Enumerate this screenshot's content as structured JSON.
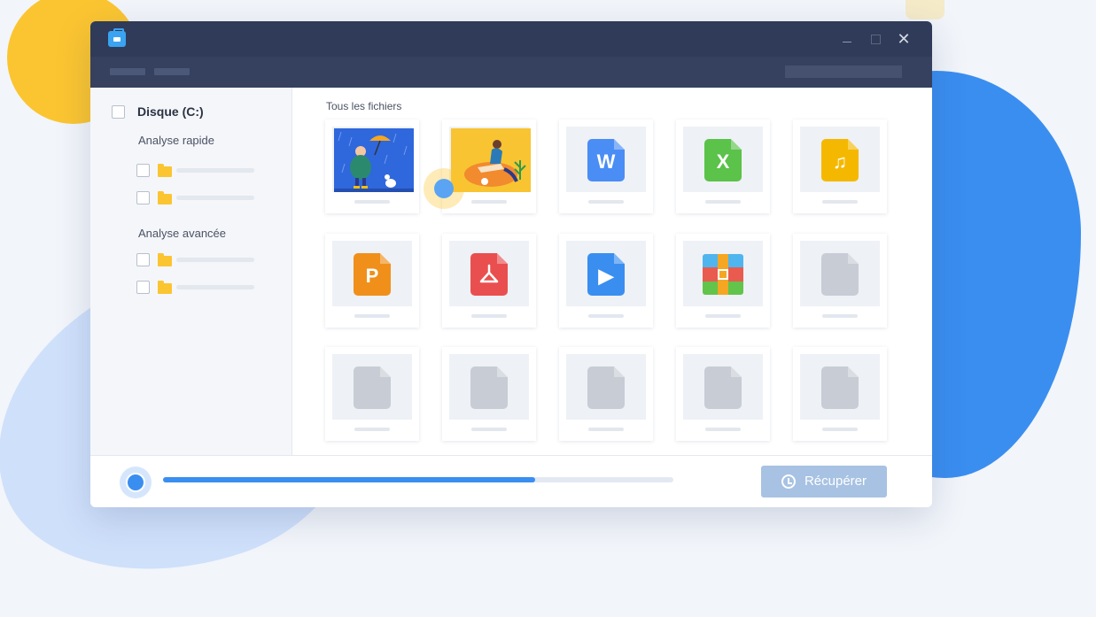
{
  "app": {
    "icon": "briefcase-icon",
    "window_controls": {
      "minimize": "minimize-icon",
      "maximize": "maximize-icon",
      "close": "close-icon"
    },
    "close_glyph": "✕"
  },
  "sidebar": {
    "disk_label": "Disque (C:)",
    "quick_scan_label": "Analyse rapide",
    "advanced_scan_label": "Analyse avancée"
  },
  "content": {
    "title": "Tous les fichiers",
    "files": [
      {
        "kind": "image",
        "icon": "image-rain-icon"
      },
      {
        "kind": "image",
        "icon": "image-sunny-icon"
      },
      {
        "kind": "word",
        "icon": "word-doc-icon",
        "letter": "W",
        "color": "#4a8df5"
      },
      {
        "kind": "excel",
        "icon": "excel-doc-icon",
        "letter": "X",
        "color": "#5bc24a"
      },
      {
        "kind": "audio",
        "icon": "music-file-icon",
        "letter": "♫",
        "color": "#f5b800"
      },
      {
        "kind": "powerpoint",
        "icon": "powerpoint-doc-icon",
        "letter": "P",
        "color": "#f0901a"
      },
      {
        "kind": "pdf",
        "icon": "pdf-doc-icon",
        "letter": "",
        "color": "#ea4f4f"
      },
      {
        "kind": "video",
        "icon": "video-file-icon",
        "letter": "▶",
        "color": "#3a8ef0"
      },
      {
        "kind": "archive",
        "icon": "archive-file-icon",
        "letter": "",
        "color": ""
      },
      {
        "kind": "generic",
        "icon": "generic-file-icon",
        "letter": "",
        "color": "#c7ccd5"
      },
      {
        "kind": "generic",
        "icon": "generic-file-icon",
        "letter": "",
        "color": "#c7ccd5"
      },
      {
        "kind": "generic",
        "icon": "generic-file-icon",
        "letter": "",
        "color": "#c7ccd5"
      },
      {
        "kind": "generic",
        "icon": "generic-file-icon",
        "letter": "",
        "color": "#c7ccd5"
      },
      {
        "kind": "generic",
        "icon": "generic-file-icon",
        "letter": "",
        "color": "#c7ccd5"
      },
      {
        "kind": "generic",
        "icon": "generic-file-icon",
        "letter": "",
        "color": "#c7ccd5"
      }
    ]
  },
  "footer": {
    "progress": 0.73,
    "recover_label": "Récupérer",
    "recover_icon": "history-icon"
  },
  "colors": {
    "accent": "#3a8ef0",
    "titlebar": "#2f3b58",
    "folder": "#fbc531"
  }
}
